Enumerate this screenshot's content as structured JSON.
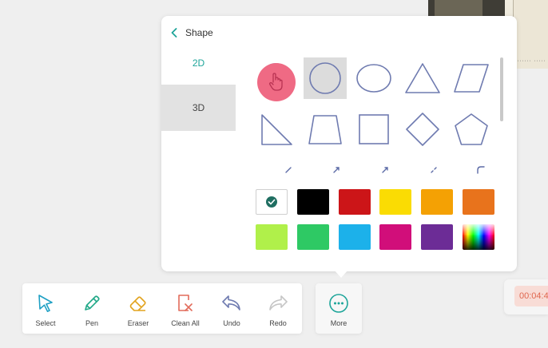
{
  "panel": {
    "title": "Shape",
    "tabs": [
      {
        "label": "2D",
        "active": true
      },
      {
        "label": "3D",
        "active": false
      }
    ],
    "shapes": [
      {
        "icon": "filled-circle-icon"
      },
      {
        "icon": "circle-icon",
        "selected": true
      },
      {
        "icon": "ellipse-icon"
      },
      {
        "icon": "triangle-icon"
      },
      {
        "icon": "parallelogram-icon"
      },
      {
        "icon": "right-triangle-icon"
      },
      {
        "icon": "trapezoid-icon"
      },
      {
        "icon": "square-icon"
      },
      {
        "icon": "diamond-icon"
      },
      {
        "icon": "pentagon-icon"
      }
    ],
    "line_tools": [
      "line-icon",
      "arrow-icon",
      "double-arrow-icon",
      "dashed-line-icon",
      "arc-icon"
    ],
    "colors": [
      "#ffffff",
      "#000000",
      "#cc1518",
      "#fadc03",
      "#f4a104",
      "#e8731c",
      "#b0f04a",
      "#2ec964",
      "#1cb1ea",
      "#d10e7a",
      "#6c2c96",
      "rainbow"
    ],
    "selected_color": "#ffffff"
  },
  "accent_color": "#1ea59a",
  "toolbar": {
    "tools": [
      {
        "label": "Select",
        "icon": "select-cursor-icon"
      },
      {
        "label": "Pen",
        "icon": "pen-icon"
      },
      {
        "label": "Eraser",
        "icon": "eraser-icon"
      },
      {
        "label": "Clean All",
        "icon": "clean-all-icon"
      },
      {
        "label": "Undo",
        "icon": "undo-icon"
      },
      {
        "label": "Redo",
        "icon": "redo-icon"
      }
    ],
    "more_label": "More"
  },
  "timer": {
    "text": "00:04:4"
  }
}
